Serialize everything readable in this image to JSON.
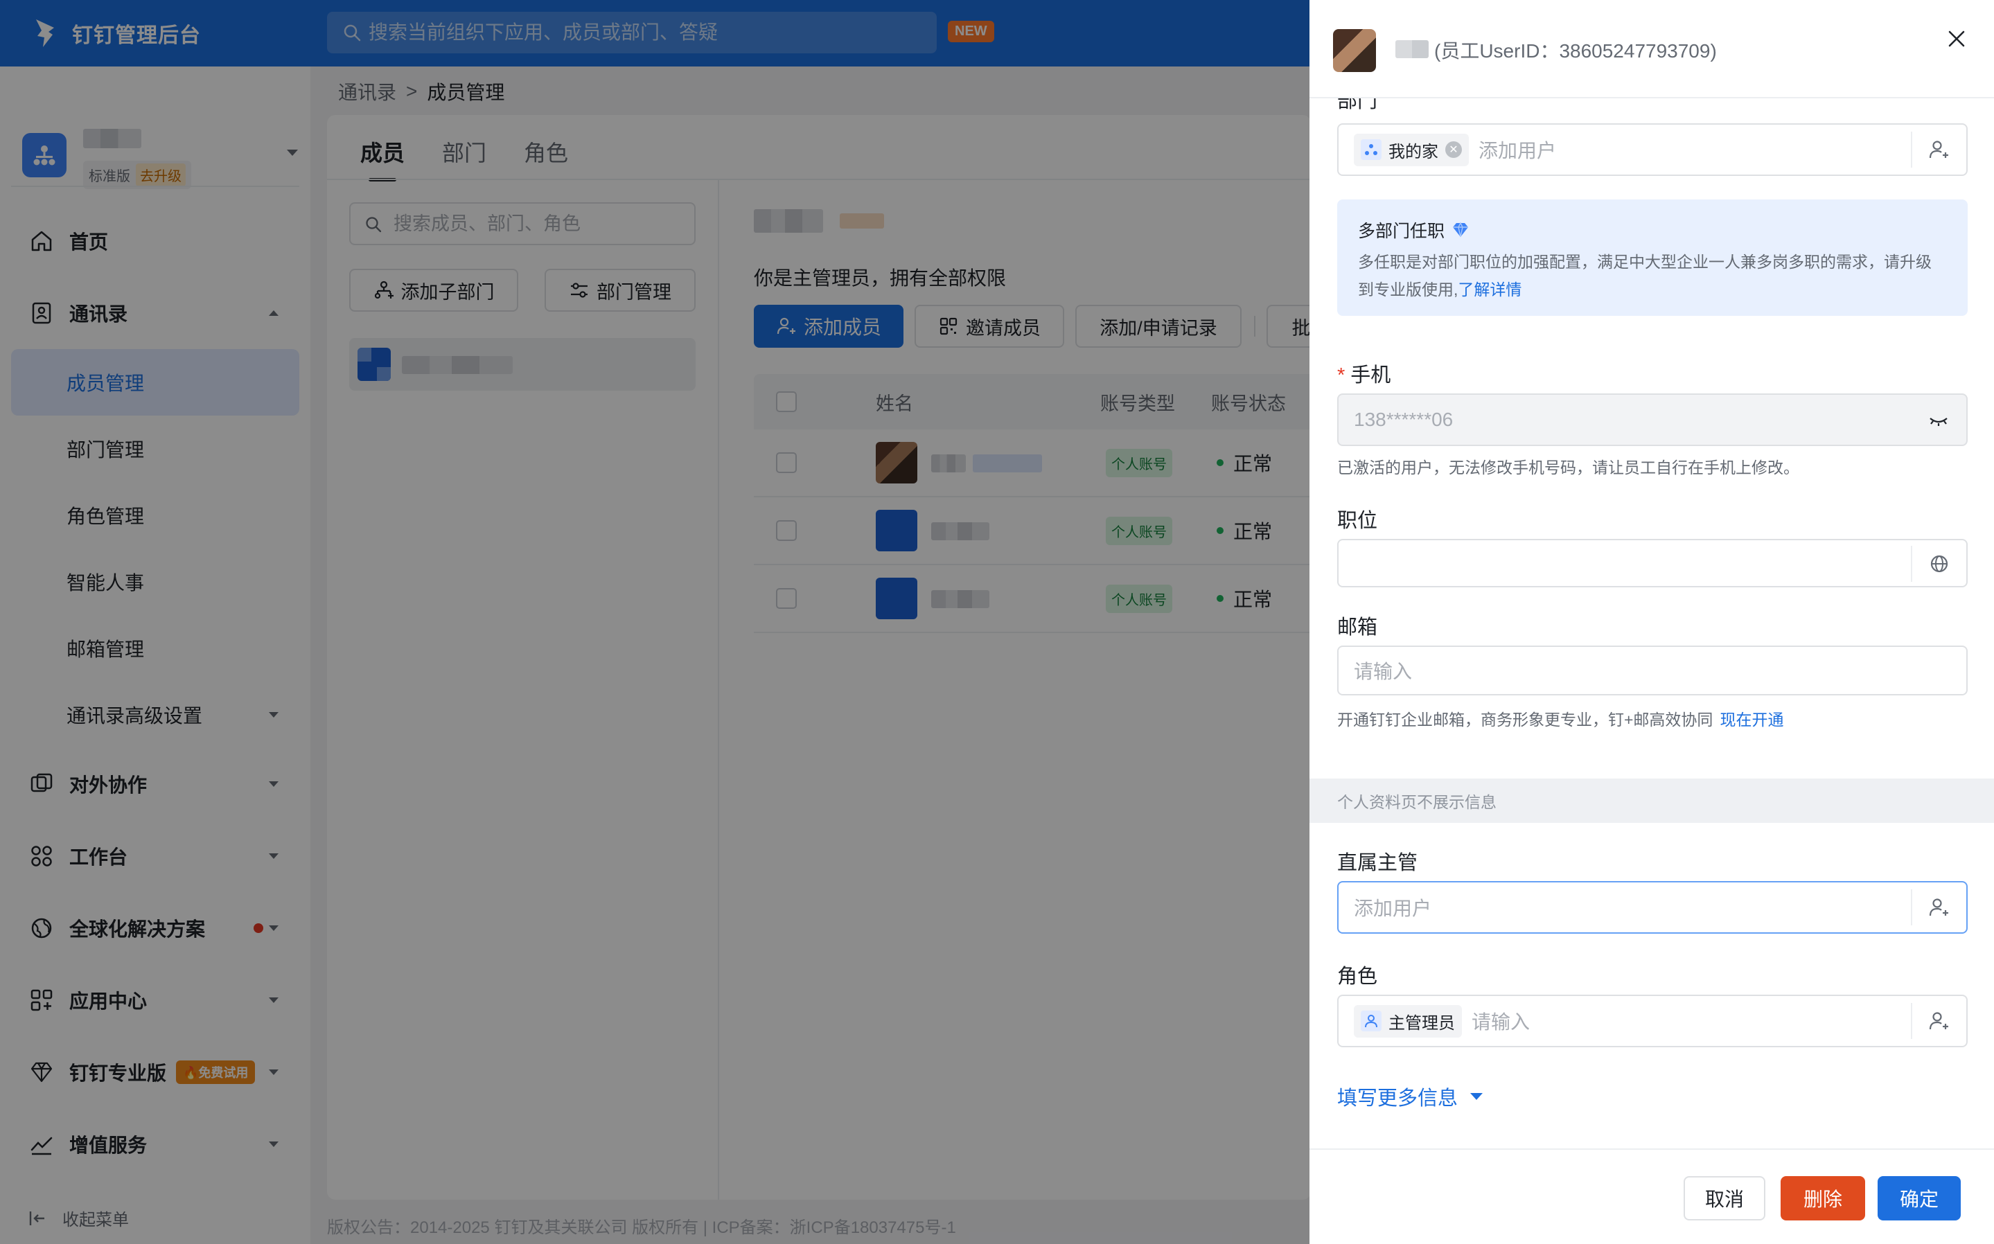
{
  "topbar": {
    "app_title": "钉钉管理后台",
    "search_placeholder": "搜索当前组织下应用、成员或部门、答疑",
    "new_badge": "NEW"
  },
  "org": {
    "edition": "标准版",
    "upgrade": "去升级"
  },
  "sidebar": {
    "items": [
      {
        "label": "首页",
        "icon": "home-icon"
      },
      {
        "label": "通讯录",
        "icon": "contacts-icon",
        "expanded": true
      },
      {
        "label": "成员管理",
        "sub": true,
        "active": true
      },
      {
        "label": "部门管理",
        "sub": true
      },
      {
        "label": "角色管理",
        "sub": true
      },
      {
        "label": "智能人事",
        "sub": true
      },
      {
        "label": "邮箱管理",
        "sub": true
      },
      {
        "label": "通讯录高级设置",
        "sub": true
      },
      {
        "label": "对外协作",
        "icon": "collaboration-icon"
      },
      {
        "label": "工作台",
        "icon": "workbench-icon"
      },
      {
        "label": "全球化解决方案",
        "icon": "globe-icon"
      },
      {
        "label": "应用中心",
        "icon": "apps-icon"
      },
      {
        "label": "钉钉专业版",
        "icon": "diamond-icon",
        "badge": "🔥免费试用"
      },
      {
        "label": "增值服务",
        "icon": "trend-icon"
      }
    ],
    "collapse_label": "收起菜单"
  },
  "breadcrumb": {
    "root": "通讯录",
    "current": "成员管理"
  },
  "tabs": [
    "成员",
    "部门",
    "角色"
  ],
  "dept_pane": {
    "search_placeholder": "搜索成员、部门、角色",
    "add_sub_dept": "添加子部门",
    "dept_manage": "部门管理"
  },
  "member_pane": {
    "admin_text": "你是主管理员，拥有全部权限",
    "add_member": "添加成员",
    "invite_member": "邀请成员",
    "records": "添加/申请记录",
    "more": "批",
    "columns": [
      "姓名",
      "账号类型",
      "账号状态"
    ],
    "rows": [
      {
        "type": "个人账号",
        "status": "正常"
      },
      {
        "type": "个人账号",
        "status": "正常"
      },
      {
        "type": "个人账号",
        "status": "正常"
      }
    ]
  },
  "copyright": "版权公告：2014-2025 钉钉及其关联公司 版权所有 | ICP备案：浙ICP备18037475号-1",
  "drawer": {
    "title": "(员工UserID：38605247793709)",
    "dept_label": "部门",
    "dept_tag": "我的家",
    "dept_placeholder": "添加用户",
    "info_title": "多部门任职",
    "info_text": "多任职是对部门职位的加强配置，满足中大型企业一人兼多岗多职的需求，请升级到专业版使用,",
    "info_link": "了解详情",
    "required_mark": "*",
    "phone_label": "手机",
    "phone_value": "138******06",
    "phone_hint": "已激活的用户，无法修改手机号码，请让员工自行在手机上修改。",
    "position_label": "职位",
    "email_label": "邮箱",
    "email_placeholder": "请输入",
    "email_hint": "开通钉钉企业邮箱，商务形象更专业，钉+邮高效协同",
    "email_link": "现在开通",
    "section_text": "个人资料页不展示信息",
    "manager_label": "直属主管",
    "manager_placeholder": "添加用户",
    "role_label": "角色",
    "role_tag": "主管理员",
    "role_placeholder": "请输入",
    "more_info": "填写更多信息",
    "cancel": "取消",
    "delete": "删除",
    "confirm": "确定"
  },
  "colors": {
    "primary": "#1d6fde",
    "danger": "#e04b1e",
    "success": "#22b35e"
  }
}
